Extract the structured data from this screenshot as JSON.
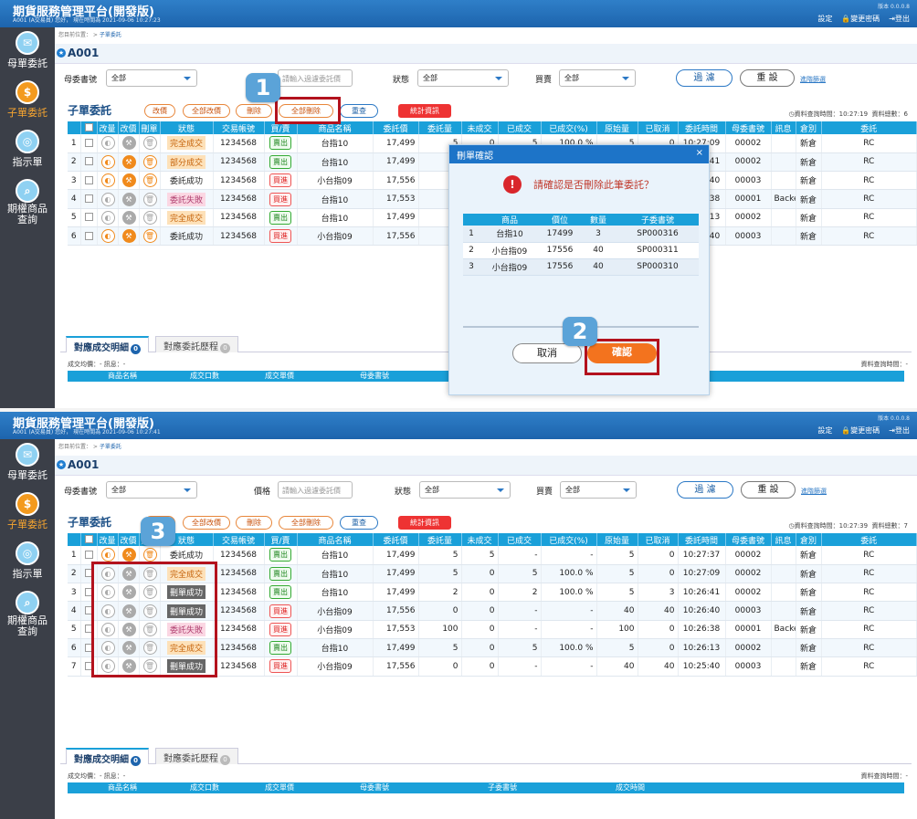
{
  "app": {
    "title": "期貨服務管理平台(開發版)",
    "version": "版本 0.0.0.8",
    "settings": "設定",
    "change_pw": "變更密碼",
    "logout": "登出"
  },
  "nav": [
    {
      "label": "母單委託",
      "icon": "ticket-icon"
    },
    {
      "label": "子單委託",
      "icon": "dollar-icon"
    },
    {
      "label": "指示單",
      "icon": "target-icon"
    },
    {
      "label": "期權商品查詢",
      "icon": "search-icon"
    }
  ],
  "breadcrumb": {
    "prefix": "您目前位置： >",
    "current": "子單委託"
  },
  "account": "A001",
  "filter": {
    "parent_label": "母委書號",
    "parent_value": "全部",
    "price_label": "價格",
    "price_placeholder": "請輸入過濾委託價",
    "status_label": "狀態",
    "status_value": "全部",
    "bs_label": "買賣",
    "bs_value": "全部",
    "filter_btn": "過 濾",
    "reset_btn": "重 設",
    "advanced": "進階篩選"
  },
  "toolbar": {
    "title": "子單委託",
    "change_qty": "改價",
    "change_all": "全部改價",
    "delete": "刪除",
    "delete_all": "全部刪除",
    "refresh": "重查",
    "stats": "統計資訊"
  },
  "columns": [
    "改量",
    "改價",
    "刪單",
    "狀態",
    "交易帳號",
    "買/賣",
    "商品名稱",
    "委託價",
    "委託量",
    "未成交",
    "已成交",
    "已成交(%)",
    "原始量",
    "已取消",
    "委託時間",
    "母委書號",
    "訊息",
    "倉別",
    "委託"
  ],
  "colhead": {
    "num": "",
    "chk": ""
  },
  "screen1": {
    "user": "A001 (A交易員)    您好，  現在時間為  2021-09-06 10:27:23",
    "query_time": "資料查詢時間：10:27:19",
    "total": "資料總數：6",
    "rows": [
      {
        "no": "1",
        "st": "完全成交",
        "stc": "done",
        "acct": "1234568",
        "bs": "賣出",
        "bsc": "sell",
        "prod": "台指10",
        "price": "17,499",
        "qty": "5",
        "unf": "0",
        "fil": "5",
        "pct": "100.0 %",
        "orig": "5",
        "can": "0",
        "time": "10:27:09",
        "parent": "00002",
        "msg": "",
        "pos": "新倉",
        "x": "RC"
      },
      {
        "no": "2",
        "st": "部分成交",
        "stc": "part",
        "acct": "1234568",
        "bs": "賣出",
        "bsc": "sell",
        "prod": "台指10",
        "price": "17,499",
        "qty": "",
        "unf": "",
        "fil": "",
        "pct": "",
        "orig": "",
        "can": "",
        "time": "10:26:41",
        "parent": "00002",
        "msg": "",
        "pos": "新倉",
        "x": "RC"
      },
      {
        "no": "3",
        "st": "委託成功",
        "stc": "ok",
        "acct": "1234568",
        "bs": "買進",
        "bsc": "buy",
        "prod": "小台指09",
        "price": "17,556",
        "qty": "",
        "unf": "",
        "fil": "",
        "pct": "",
        "orig": "",
        "can": "",
        "time": "10:26:40",
        "parent": "00003",
        "msg": "",
        "pos": "新倉",
        "x": "RC"
      },
      {
        "no": "4",
        "st": "委託失敗",
        "stc": "fail",
        "acct": "1234568",
        "bs": "買進",
        "bsc": "buy",
        "prod": "台指10",
        "price": "17,553",
        "qty": "",
        "unf": "",
        "fil": "",
        "pct": "",
        "orig": "",
        "can": "",
        "time": "10:26:38",
        "parent": "00001",
        "msg": "Backen...",
        "pos": "新倉",
        "x": "RC"
      },
      {
        "no": "5",
        "st": "完全成交",
        "stc": "done",
        "acct": "1234568",
        "bs": "賣出",
        "bsc": "sell",
        "prod": "台指10",
        "price": "17,499",
        "qty": "",
        "unf": "",
        "fil": "",
        "pct": "",
        "orig": "",
        "can": "",
        "time": "10:26:13",
        "parent": "00002",
        "msg": "",
        "pos": "新倉",
        "x": "RC"
      },
      {
        "no": "6",
        "st": "委託成功",
        "stc": "ok",
        "acct": "1234568",
        "bs": "買進",
        "bsc": "buy",
        "prod": "小台指09",
        "price": "17,556",
        "qty": "",
        "unf": "",
        "fil": "",
        "pct": "",
        "orig": "",
        "can": "",
        "time": "10:25:40",
        "parent": "00003",
        "msg": "",
        "pos": "新倉",
        "x": "RC"
      }
    ]
  },
  "screen2": {
    "user": "A001 (A交易員)    您好，  現在時間為  2021-09-06 10:27:41",
    "query_time": "資料查詢時間：10:27:39",
    "total": "資料總數：7",
    "rows": [
      {
        "no": "1",
        "st": "委託成功",
        "stc": "ok",
        "acct": "1234568",
        "bs": "賣出",
        "bsc": "sell",
        "prod": "台指10",
        "price": "17,499",
        "qty": "5",
        "unf": "5",
        "fil": "-",
        "pct": "-",
        "orig": "5",
        "can": "0",
        "time": "10:27:37",
        "parent": "00002",
        "msg": "",
        "pos": "新倉",
        "x": "RC"
      },
      {
        "no": "2",
        "st": "完全成交",
        "stc": "done",
        "acct": "1234568",
        "bs": "賣出",
        "bsc": "sell",
        "prod": "台指10",
        "price": "17,499",
        "qty": "5",
        "unf": "0",
        "fil": "5",
        "pct": "100.0 %",
        "orig": "5",
        "can": "0",
        "time": "10:27:09",
        "parent": "00002",
        "msg": "",
        "pos": "新倉",
        "x": "RC"
      },
      {
        "no": "3",
        "st": "刪單成功",
        "stc": "del",
        "acct": "1234568",
        "bs": "賣出",
        "bsc": "sell",
        "prod": "台指10",
        "price": "17,499",
        "qty": "2",
        "unf": "0",
        "fil": "2",
        "pct": "100.0 %",
        "orig": "5",
        "can": "3",
        "time": "10:26:41",
        "parent": "00002",
        "msg": "",
        "pos": "新倉",
        "x": "RC"
      },
      {
        "no": "4",
        "st": "刪單成功",
        "stc": "del",
        "acct": "1234568",
        "bs": "買進",
        "bsc": "buy",
        "prod": "小台指09",
        "price": "17,556",
        "qty": "0",
        "unf": "0",
        "fil": "-",
        "pct": "-",
        "orig": "40",
        "can": "40",
        "time": "10:26:40",
        "parent": "00003",
        "msg": "",
        "pos": "新倉",
        "x": "RC"
      },
      {
        "no": "5",
        "st": "委託失敗",
        "stc": "fail",
        "acct": "1234568",
        "bs": "買進",
        "bsc": "buy",
        "prod": "小台指09",
        "price": "17,553",
        "qty": "100",
        "unf": "0",
        "fil": "-",
        "pct": "-",
        "orig": "100",
        "can": "0",
        "time": "10:26:38",
        "parent": "00001",
        "msg": "Backen...",
        "pos": "新倉",
        "x": "RC"
      },
      {
        "no": "6",
        "st": "完全成交",
        "stc": "done",
        "acct": "1234568",
        "bs": "賣出",
        "bsc": "sell",
        "prod": "台指10",
        "price": "17,499",
        "qty": "5",
        "unf": "0",
        "fil": "5",
        "pct": "100.0 %",
        "orig": "5",
        "can": "0",
        "time": "10:26:13",
        "parent": "00002",
        "msg": "",
        "pos": "新倉",
        "x": "RC"
      },
      {
        "no": "7",
        "st": "刪單成功",
        "stc": "del",
        "acct": "1234568",
        "bs": "買進",
        "bsc": "buy",
        "prod": "小台指09",
        "price": "17,556",
        "qty": "0",
        "unf": "0",
        "fil": "-",
        "pct": "-",
        "orig": "40",
        "can": "40",
        "time": "10:25:40",
        "parent": "00003",
        "msg": "",
        "pos": "新倉",
        "x": "RC"
      }
    ]
  },
  "bottom": {
    "tab1": "對應成交明細",
    "tab1_count": "0",
    "tab2": "對應委託歷程",
    "tab2_count": "0",
    "avg": "成交均價：-       訊息：-",
    "query": "資料查詢時間：-",
    "cols": [
      "商品名稱",
      "成交口數",
      "成交單價",
      "母委書號",
      "子委書號",
      "成交時間"
    ]
  },
  "modal": {
    "title": "刪單確認",
    "close": "×",
    "question": "請確認是否刪除此筆委託？",
    "cols": [
      "",
      "商品",
      "價位",
      "數量",
      "子委書號"
    ],
    "rows": [
      [
        "1",
        "台指10",
        "17499",
        "3",
        "SP000316"
      ],
      [
        "2",
        "小台指09",
        "17556",
        "40",
        "SP000311"
      ],
      [
        "3",
        "小台指09",
        "17556",
        "40",
        "SP000310"
      ]
    ],
    "cancel": "取消",
    "confirm": "確認"
  },
  "callouts": [
    "1",
    "2",
    "3"
  ]
}
